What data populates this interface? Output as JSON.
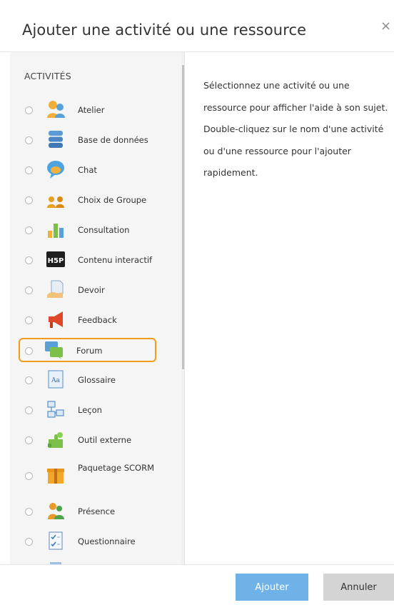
{
  "dialog": {
    "title": "Ajouter une activité ou une ressource",
    "close_symbol": "×"
  },
  "section_title": "ACTIVITÉS",
  "activities": [
    {
      "label": "Atelier",
      "icon": "workshop-icon"
    },
    {
      "label": "Base de données",
      "icon": "database-icon"
    },
    {
      "label": "Chat",
      "icon": "chat-icon"
    },
    {
      "label": "Choix de Groupe",
      "icon": "group-choice-icon"
    },
    {
      "label": "Consultation",
      "icon": "bar-chart-icon"
    },
    {
      "label": "Contenu interactif",
      "icon": "h5p-icon"
    },
    {
      "label": "Devoir",
      "icon": "assignment-icon"
    },
    {
      "label": "Feedback",
      "icon": "megaphone-icon"
    },
    {
      "label": "Forum",
      "icon": "forum-icon",
      "highlighted": true
    },
    {
      "label": "Glossaire",
      "icon": "glossary-icon"
    },
    {
      "label": "Leçon",
      "icon": "lesson-icon"
    },
    {
      "label": "Outil externe",
      "icon": "puzzle-icon"
    },
    {
      "label": "Paquetage SCORM",
      "icon": "package-icon"
    },
    {
      "label": "Présence",
      "icon": "attendance-icon"
    },
    {
      "label": "Questionnaire",
      "icon": "questionnaire-icon"
    }
  ],
  "help_text": "Sélectionnez une activité ou une ressource pour afficher l'aide à son sujet. Double-cliquez sur le nom d'une activité ou d'une ressource pour l'ajouter rapidement.",
  "buttons": {
    "add": "Ajouter",
    "cancel": "Annuler"
  },
  "colors": {
    "highlight": "#f59b1b",
    "primary": "#6fb2e8",
    "secondary": "#d4d4d4"
  }
}
